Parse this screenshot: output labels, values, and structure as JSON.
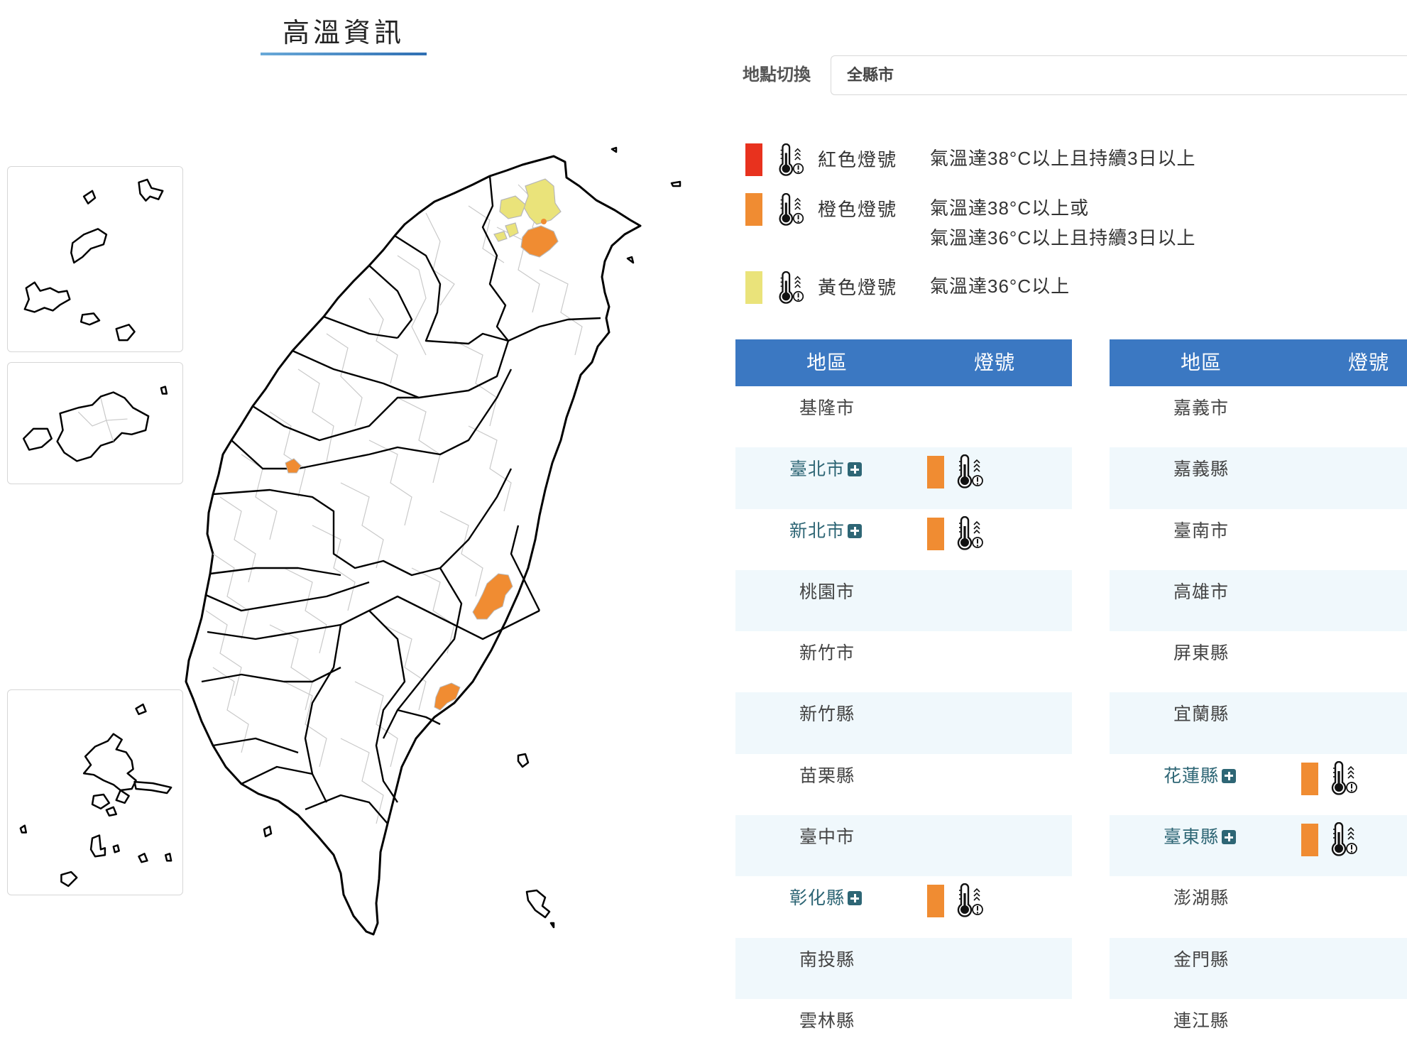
{
  "header": {
    "title": "高溫資訊"
  },
  "location": {
    "label": "地點切換",
    "selected": "全縣市"
  },
  "colors": {
    "red": "#e8321e",
    "orange": "#f08c32",
    "yellow": "#eae37a",
    "header_blue": "#3b78c2",
    "row_alt": "#f0f8fc",
    "link": "#2e6675"
  },
  "legend": [
    {
      "name": "紅色燈號",
      "color": "#e8321e",
      "desc": [
        "氣溫達38°C以上且持續3日以上"
      ],
      "icon": "thermometer-icon"
    },
    {
      "name": "橙色燈號",
      "color": "#f08c32",
      "desc": [
        "氣溫達38°C以上或",
        "氣溫達36°C以上且持續3日以上"
      ],
      "icon": "thermometer-icon"
    },
    {
      "name": "黃色燈號",
      "color": "#eae37a",
      "desc": [
        "氣溫達36°C以上"
      ],
      "icon": "thermometer-icon"
    }
  ],
  "table": {
    "headers": {
      "region": "地區",
      "signal": "燈號"
    },
    "left": [
      {
        "name": "基隆市",
        "signal": ""
      },
      {
        "name": "臺北市",
        "signal": "orange"
      },
      {
        "name": "新北市",
        "signal": "orange"
      },
      {
        "name": "桃園市",
        "signal": ""
      },
      {
        "name": "新竹市",
        "signal": ""
      },
      {
        "name": "新竹縣",
        "signal": ""
      },
      {
        "name": "苗栗縣",
        "signal": ""
      },
      {
        "name": "臺中市",
        "signal": ""
      },
      {
        "name": "彰化縣",
        "signal": "orange"
      },
      {
        "name": "南投縣",
        "signal": ""
      },
      {
        "name": "雲林縣",
        "signal": ""
      }
    ],
    "right": [
      {
        "name": "嘉義市",
        "signal": ""
      },
      {
        "name": "嘉義縣",
        "signal": ""
      },
      {
        "name": "臺南市",
        "signal": ""
      },
      {
        "name": "高雄市",
        "signal": ""
      },
      {
        "name": "屏東縣",
        "signal": ""
      },
      {
        "name": "宜蘭縣",
        "signal": ""
      },
      {
        "name": "花蓮縣",
        "signal": "orange"
      },
      {
        "name": "臺東縣",
        "signal": "orange"
      },
      {
        "name": "澎湖縣",
        "signal": ""
      },
      {
        "name": "金門縣",
        "signal": ""
      },
      {
        "name": "連江縣",
        "signal": ""
      }
    ]
  }
}
